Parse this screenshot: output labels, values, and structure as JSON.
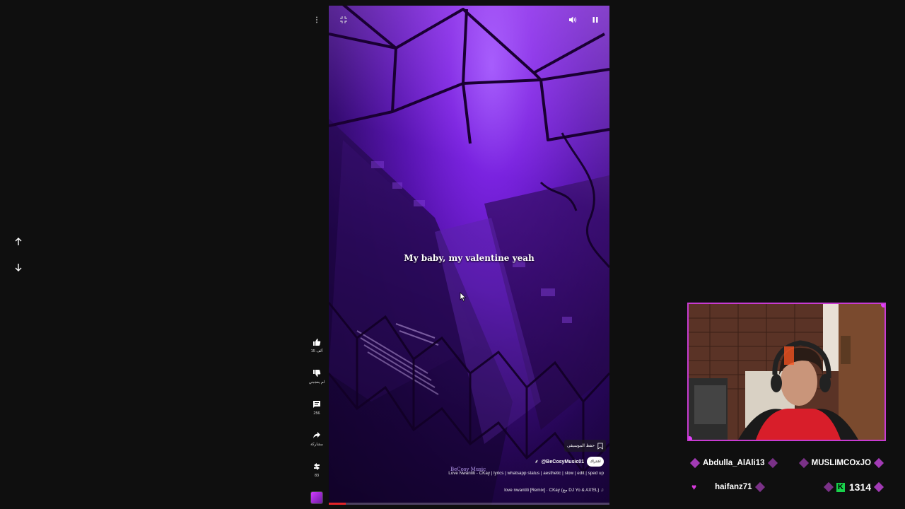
{
  "video": {
    "subtitle": "My baby, my valentine yeah",
    "save_label": "حفظ الموسيقى",
    "channel_handle": "@BeCosyMusic01",
    "subscribe_label": "اشتراك",
    "watermark": "BeCosy Music",
    "description": "Love Nwantiti - CKay | lyrics | whatsapp status | aesthetic | slow | edit | sped up",
    "song": "love nwantiti [Remix] · CKay (مع DJ Yo & AX'EL)",
    "progress_fraction": 0.06
  },
  "actions": {
    "like_count": "15 ألف",
    "dislike_label": "لم يعجبني",
    "comment_count": "256",
    "share_label": "مشاركة",
    "remix_count": "83"
  },
  "chat": {
    "user1": "Abdulla_AlAli13",
    "user2": "MUSLIMCOxJO",
    "user3": "haifanz71",
    "viewer_count": "1314"
  },
  "colors": {
    "accent": "#c73bd1",
    "kick_green": "#19d14b",
    "progress_red": "#e5252a"
  },
  "icons": [
    "more-vert-icon",
    "collapse-icon",
    "volume-icon",
    "pause-icon",
    "arrow-up-icon",
    "arrow-down-icon",
    "thumb-up-icon",
    "thumb-down-icon",
    "comment-icon",
    "share-icon",
    "remix-icon",
    "bookmark-icon"
  ]
}
